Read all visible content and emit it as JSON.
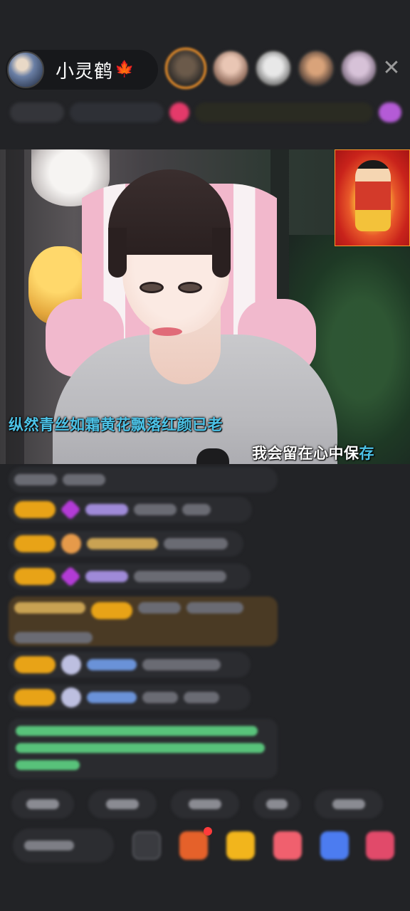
{
  "header": {
    "host_name": "小灵鹤",
    "host_emoji": "🍁",
    "close_glyph": "✕",
    "viewer_avatar_count": 5
  },
  "video": {
    "lyric_line_1": "纵然青丝如霜黄花飘落红颜已老",
    "lyric_line_2_main": "我会留在心中保",
    "lyric_line_2_highlight": "存",
    "lyric_color": "#4cc2e6"
  },
  "colors": {
    "background": "#222326",
    "badge_gold": "#e8a317",
    "chat_green": "#58c27a",
    "accent_orange": "#ff9a2a"
  },
  "icons": {
    "close": "close-icon",
    "leaf": "maple-leaf-icon",
    "gift": "gift-icon",
    "game": "gamepad-icon",
    "more": "more-icon",
    "emoji": "emoji-icon"
  }
}
